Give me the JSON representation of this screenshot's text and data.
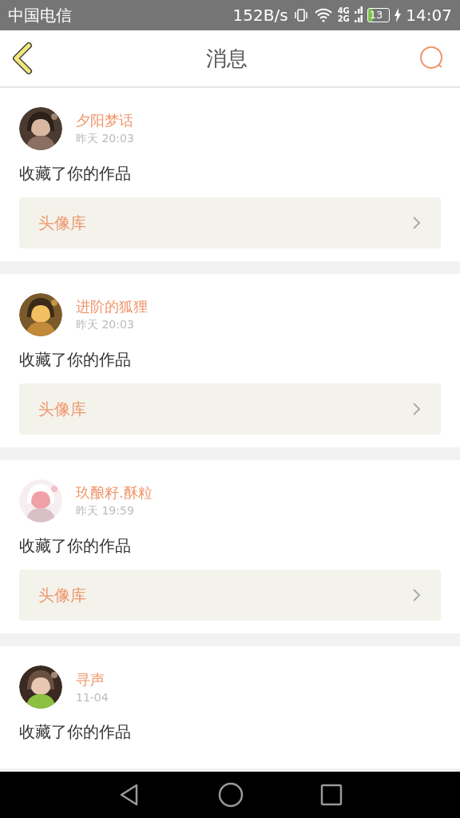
{
  "status_bar": {
    "carrier": "中国电信",
    "speed": "152B/s",
    "network_top": "4G",
    "network_bottom": "2G",
    "battery": "13",
    "time": "14:07"
  },
  "header": {
    "title": "消息"
  },
  "messages": [
    {
      "name": "夕阳梦话",
      "time": "昨天 20:03",
      "action": "收藏了你的作品",
      "link": "头像库"
    },
    {
      "name": "进阶的狐狸",
      "time": "昨天 20:03",
      "action": "收藏了你的作品",
      "link": "头像库"
    },
    {
      "name": "玖酿籽.酥粒",
      "time": "昨天 19:59",
      "action": "收藏了你的作品",
      "link": "头像库"
    },
    {
      "name": "寻声",
      "time": "11-04",
      "action": "收藏了你的作品"
    }
  ]
}
